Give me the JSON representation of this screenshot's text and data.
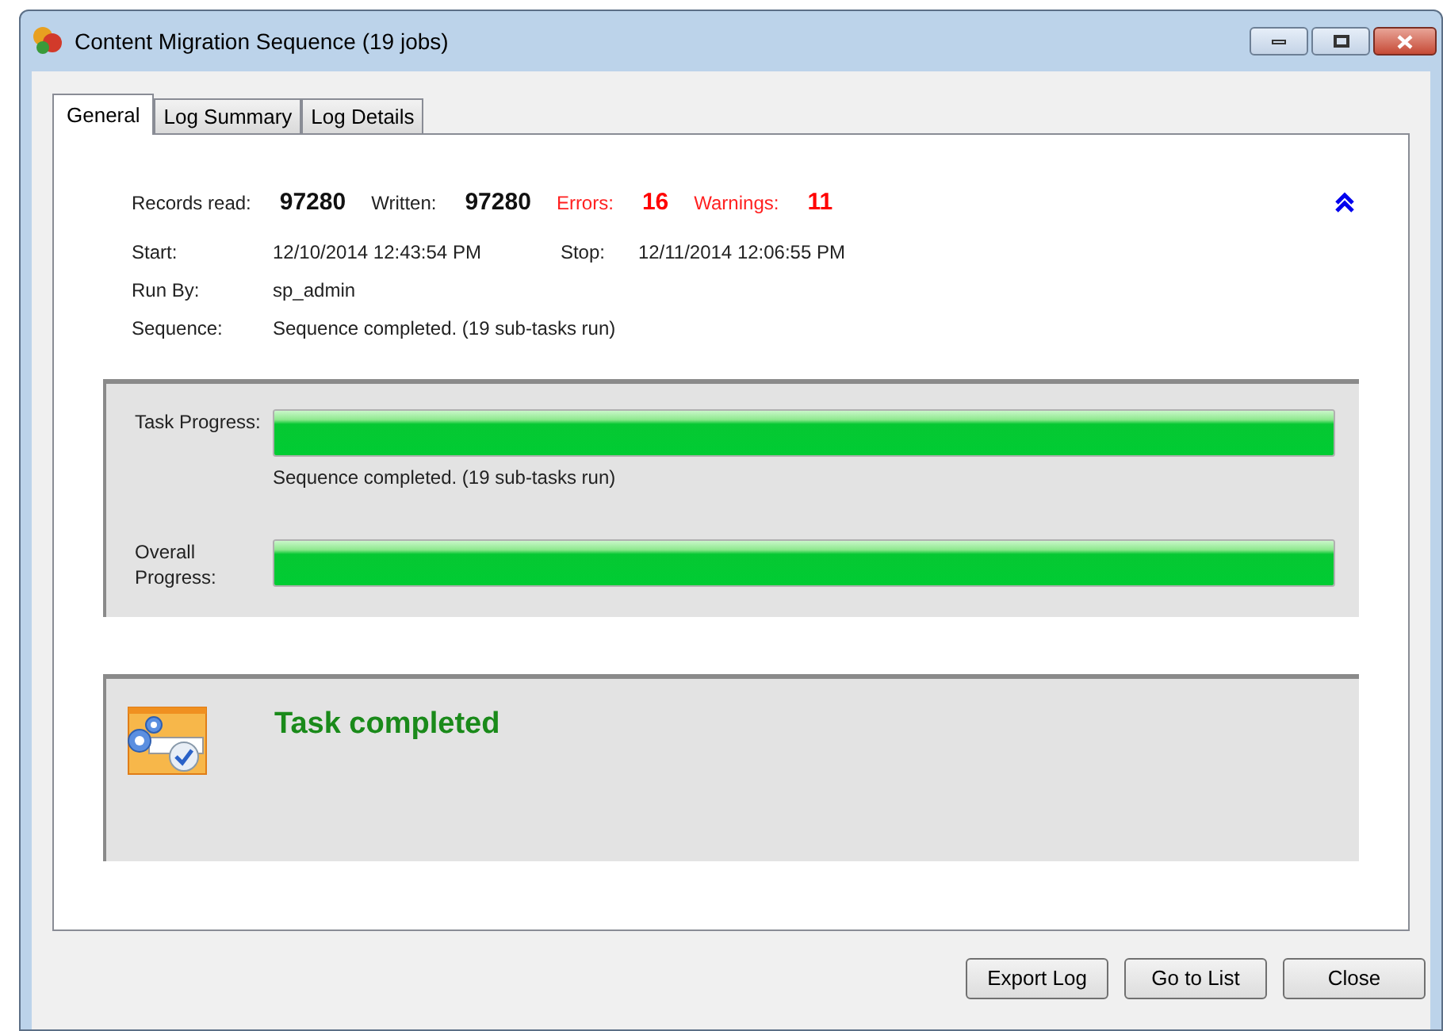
{
  "window": {
    "title": "Content Migration Sequence (19 jobs)"
  },
  "tabs": [
    {
      "label": "General",
      "selected": true
    },
    {
      "label": "Log Summary",
      "selected": false
    },
    {
      "label": "Log Details",
      "selected": false
    }
  ],
  "stats": [
    {
      "label": "Records read:",
      "value": "97280",
      "kind": "normal"
    },
    {
      "label": "Written:",
      "value": "97280",
      "kind": "normal"
    },
    {
      "label": "Errors:",
      "value": "16",
      "kind": "alert"
    },
    {
      "label": "Warnings:",
      "value": "11",
      "kind": "alert"
    }
  ],
  "details": {
    "start_label": "Start:",
    "start": "12/10/2014 12:43:54 PM",
    "stop_label": "Stop:",
    "stop": "12/11/2014 12:06:55 PM",
    "run_by_label": "Run By:",
    "run_by": "sp_admin",
    "sequence_label": "Sequence:",
    "sequence": "Sequence completed. (19 sub-tasks run)"
  },
  "progress": [
    {
      "label": "Task Progress:",
      "level": 1,
      "note": "Sequence completed. (19 sub-tasks run)"
    },
    {
      "label": "Overall Progress:",
      "level": 1
    }
  ],
  "status": {
    "message": "Task completed"
  },
  "buttons": [
    "Export Log",
    "Go to List",
    "Close"
  ]
}
